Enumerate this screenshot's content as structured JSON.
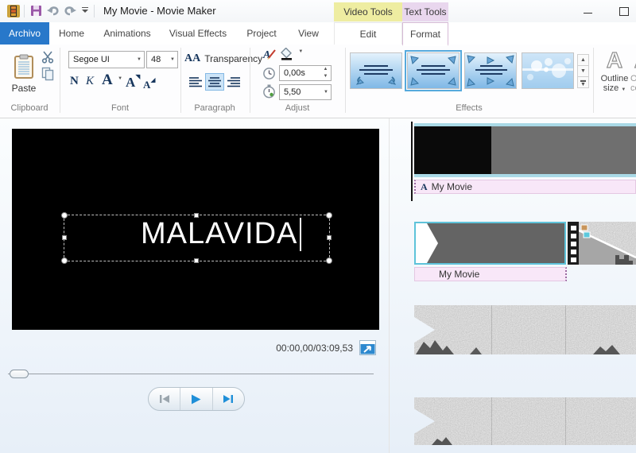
{
  "window": {
    "title": "My Movie - Movie Maker"
  },
  "tabs": {
    "file": "Archivo",
    "main": [
      "Home",
      "Animations",
      "Visual Effects",
      "Project",
      "View"
    ],
    "contextual": [
      {
        "group": "Video Tools",
        "tab": "Edit",
        "color": "#eeeda1"
      },
      {
        "group": "Text Tools",
        "tab": "Format",
        "color": "#e9d7ee"
      }
    ]
  },
  "ribbon": {
    "clipboard": {
      "paste": "Paste",
      "label": "Clipboard"
    },
    "font": {
      "family": "Segoe UI",
      "size": "48",
      "bold": "N",
      "italic": "K",
      "color_letter": "A",
      "grow_letter": "A",
      "shrink_letter": "A",
      "label": "Font"
    },
    "paragraph": {
      "transparency": "Transparency",
      "aa": "AA",
      "label": "Paragraph"
    },
    "adjust": {
      "start_time": "0,00s",
      "duration": "5,50",
      "label": "Adjust"
    },
    "effects": {
      "label": "Effects"
    },
    "outline": {
      "letter": "A",
      "line1": "Outline",
      "line2": "size",
      "partial_line1": "Ou",
      "partial_line2": "co"
    }
  },
  "preview": {
    "overlay_text": "MALAVIDA",
    "timecode": "00:00,00/03:09,53"
  },
  "timeline": {
    "clip1_icon": "A",
    "clip1_label": "My Movie",
    "clip2_label": "My Movie"
  },
  "colors": {
    "file_tab_blue": "#2878ca",
    "video_tools_yellow": "#eeeda1",
    "text_tools_pink": "#e9d7ee",
    "selection_cyan": "#5ec3da",
    "caption_pink": "#f8e7f8",
    "play_blue": "#1f8fd8",
    "effect_selected_border": "#56aadd"
  }
}
